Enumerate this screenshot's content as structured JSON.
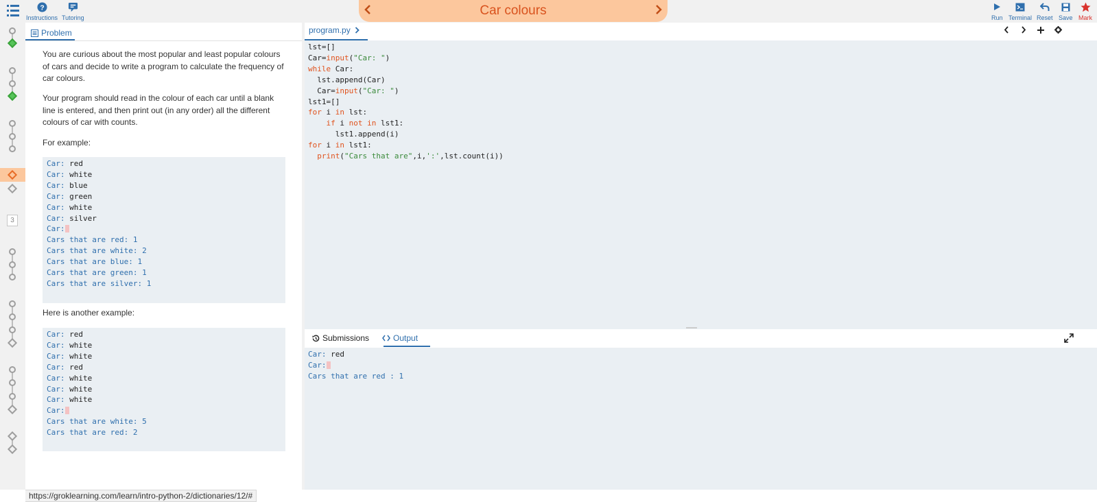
{
  "topbar": {
    "instructions_label": "Instructions",
    "tutoring_label": "Tutoring",
    "title": "Car colours",
    "prev_arrow": "‹",
    "next_arrow": "›",
    "run_label": "Run",
    "terminal_label": "Terminal",
    "reset_label": "Reset",
    "save_label": "Save",
    "mark_label": "Mark"
  },
  "rail": {
    "badge": "3"
  },
  "problem": {
    "tab_label": "Problem",
    "p1": "You are curious about the most popular and least popular colours of cars and decide to write a program to calculate the frequency of car colours.",
    "p2": "Your program should read in the colour of each car until a blank line is entered, and then print out (in any order) all the different colours of car with counts.",
    "p3": "For example:",
    "example1": [
      {
        "prompt": "Car: ",
        "value": "red"
      },
      {
        "prompt": "Car: ",
        "value": "white"
      },
      {
        "prompt": "Car: ",
        "value": "blue"
      },
      {
        "prompt": "Car: ",
        "value": "green"
      },
      {
        "prompt": "Car: ",
        "value": "white"
      },
      {
        "prompt": "Car: ",
        "value": "silver"
      },
      {
        "prompt": "Car:",
        "value": ""
      },
      {
        "prompt": "Cars that are red: 1",
        "value": ""
      },
      {
        "prompt": "Cars that are white: 2",
        "value": ""
      },
      {
        "prompt": "Cars that are blue: 1",
        "value": ""
      },
      {
        "prompt": "Cars that are green: 1",
        "value": ""
      },
      {
        "prompt": "Cars that are silver: 1",
        "value": ""
      }
    ],
    "p4": "Here is another example:",
    "example2": [
      {
        "prompt": "Car: ",
        "value": "red"
      },
      {
        "prompt": "Car: ",
        "value": "white"
      },
      {
        "prompt": "Car: ",
        "value": "white"
      },
      {
        "prompt": "Car: ",
        "value": "red"
      },
      {
        "prompt": "Car: ",
        "value": "white"
      },
      {
        "prompt": "Car: ",
        "value": "white"
      },
      {
        "prompt": "Car: ",
        "value": "white"
      },
      {
        "prompt": "Car:",
        "value": ""
      },
      {
        "prompt": "Cars that are white: 5",
        "value": ""
      },
      {
        "prompt": "Cars that are red: 2",
        "value": ""
      }
    ]
  },
  "status_url": "https://groklearning.com/learn/intro-python-2/dictionaries/12/#",
  "editor": {
    "filename": "program.py",
    "code": [
      [
        [
          "t",
          "lst=[]"
        ]
      ],
      [
        [
          "t",
          "Car="
        ],
        [
          "k",
          "input"
        ],
        [
          "t",
          "("
        ],
        [
          "s",
          "\"Car: \""
        ],
        [
          "t",
          ")"
        ]
      ],
      [
        [
          "k",
          "while"
        ],
        [
          "t",
          " Car:"
        ]
      ],
      [
        [
          "t",
          "  lst.append(Car)"
        ]
      ],
      [
        [
          "t",
          "  Car="
        ],
        [
          "k",
          "input"
        ],
        [
          "t",
          "("
        ],
        [
          "s",
          "\"Car: \""
        ],
        [
          "t",
          ")"
        ]
      ],
      [
        [
          "t",
          "lst1=[]"
        ]
      ],
      [
        [
          "k",
          "for"
        ],
        [
          "t",
          " i "
        ],
        [
          "k",
          "in"
        ],
        [
          "t",
          " lst:"
        ]
      ],
      [
        [
          "t",
          "    "
        ],
        [
          "k",
          "if"
        ],
        [
          "t",
          " i "
        ],
        [
          "k",
          "not"
        ],
        [
          "t",
          " "
        ],
        [
          "k",
          "in"
        ],
        [
          "t",
          " lst1:"
        ]
      ],
      [
        [
          "t",
          "      lst1.append(i)"
        ]
      ],
      [
        [
          "k",
          "for"
        ],
        [
          "t",
          " i "
        ],
        [
          "k",
          "in"
        ],
        [
          "t",
          " lst1:"
        ]
      ],
      [
        [
          "t",
          "  "
        ],
        [
          "k",
          "print"
        ],
        [
          "t",
          "("
        ],
        [
          "s",
          "\"Cars that are\""
        ],
        [
          "t",
          ",i,"
        ],
        [
          "s",
          "':'"
        ],
        [
          "t",
          ",lst.count(i))"
        ]
      ]
    ]
  },
  "output": {
    "submissions_label": "Submissions",
    "output_label": "Output",
    "lines": [
      {
        "prompt": "Car: ",
        "value": "red"
      },
      {
        "prompt": "Car:",
        "value": ""
      },
      {
        "prompt": "Cars that are red : 1",
        "value": ""
      }
    ]
  },
  "colors": {
    "accent": "#2f6fad",
    "title_bg": "#fcc79d",
    "title_text": "#d9531e",
    "code_bg": "#eaeff3",
    "keyword": "#e0531e",
    "string": "#3a8a3a",
    "mark": "#d9322c"
  }
}
